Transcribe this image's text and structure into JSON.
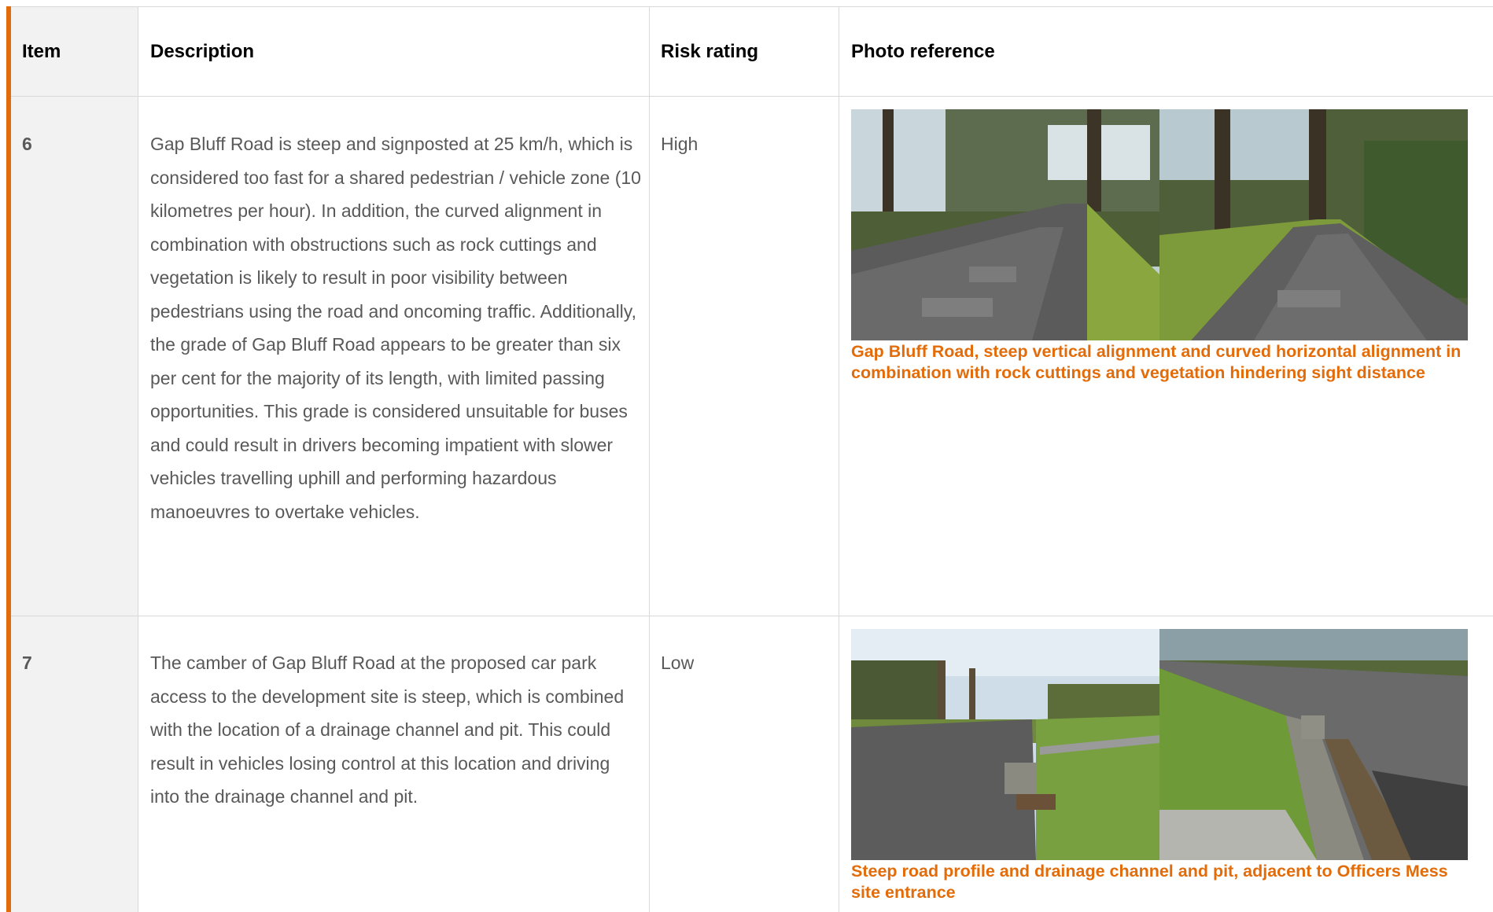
{
  "table": {
    "headers": {
      "item": "Item",
      "description": "Description",
      "risk": "Risk rating",
      "photo": "Photo reference"
    },
    "rows": [
      {
        "item": "6",
        "description": "Gap Bluff Road is steep and signposted at 25 km/h, which is considered too fast for a shared pedestrian / vehicle zone (10 kilometres per hour). In addition, the curved alignment in combination with obstructions such as rock cuttings and vegetation is likely to result in poor visibility between pedestrians using the road and oncoming traffic. Additionally, the grade of Gap Bluff Road appears to be greater than six per cent for the majority of its length, with limited passing opportunities. This grade is considered unsuitable for buses and could result in drivers becoming impatient with slower vehicles travelling uphill and performing hazardous manoeuvres to overtake vehicles.",
        "risk": "High",
        "caption": "Gap Bluff Road, steep vertical alignment and curved horizontal alignment in combination with rock cuttings and vegetation hindering sight distance"
      },
      {
        "item": "7",
        "description": "The camber of Gap Bluff Road at the proposed car park access to the development site is steep, which is combined with the location of a drainage channel and pit. This could result in vehicles losing control at this location and driving into the drainage channel and pit.",
        "risk": "Low",
        "caption": "Steep road profile and drainage channel and pit, adjacent to Officers Mess site entrance"
      }
    ]
  },
  "colors": {
    "accent": "#e36c0a",
    "grid": "#d9d9d9",
    "item_column_bg": "#f2f2f2"
  }
}
